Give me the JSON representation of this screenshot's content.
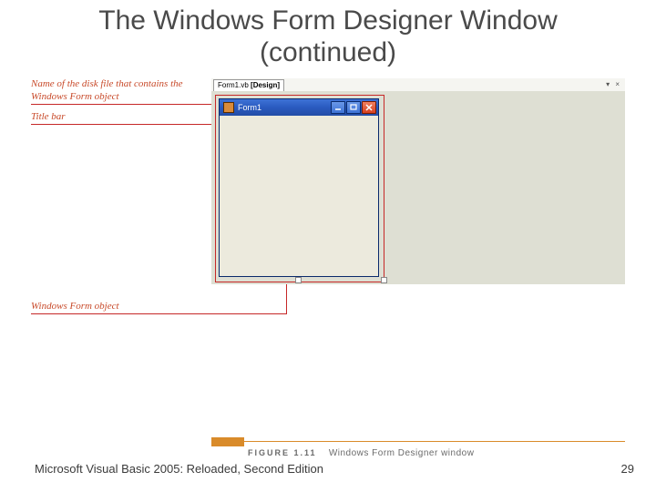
{
  "slide": {
    "title_line1": "The Windows Form Designer Window",
    "title_line2": "(continued)"
  },
  "annotations": {
    "disk_file": "Name of the disk file that contains the Windows Form object",
    "title_bar": "Title bar",
    "form_object": "Windows Form object"
  },
  "designer": {
    "tab_filename": "Form1.vb",
    "tab_suffix": "[Design]",
    "tab_right_icons": "▾  ×",
    "form_title": "Form1"
  },
  "caption": {
    "fig_label": "FIGURE 1.11",
    "fig_text": "Windows Form Designer window"
  },
  "footer": {
    "left": "Microsoft Visual Basic 2005: Reloaded, Second Edition",
    "page": "29"
  }
}
